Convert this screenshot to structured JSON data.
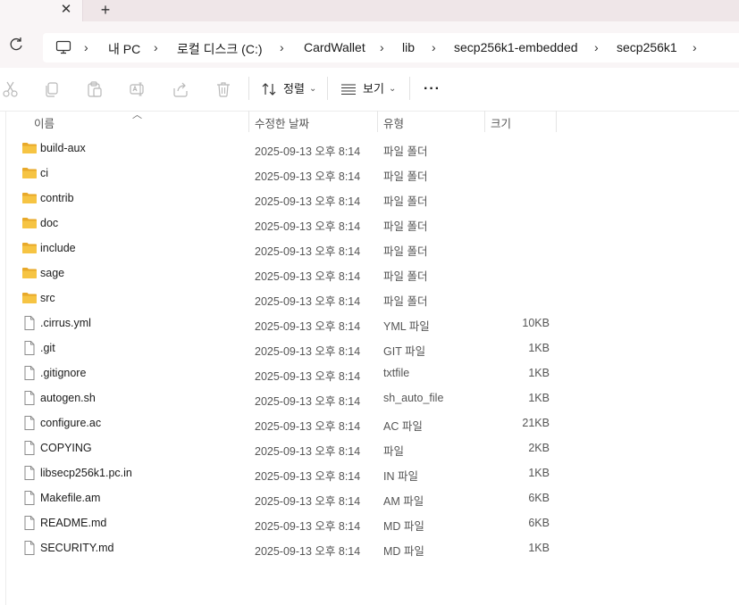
{
  "tabs": {
    "close_glyph": "✕",
    "new_glyph": "+"
  },
  "breadcrumb": [
    "내 PC",
    "로컬 디스크 (C:)",
    "CardWallet",
    "lib",
    "secp256k1-embedded",
    "secp256k1"
  ],
  "toolbar": {
    "sort_label": "정렬",
    "view_label": "보기",
    "more_label": "···"
  },
  "columns": {
    "name": "이름",
    "date": "수정한 날짜",
    "type": "유형",
    "size": "크기"
  },
  "files": [
    {
      "name": "build-aux",
      "date": "2025-09-13 오후 8:14",
      "type": "파일 폴더",
      "size": "",
      "kind": "folder"
    },
    {
      "name": "ci",
      "date": "2025-09-13 오후 8:14",
      "type": "파일 폴더",
      "size": "",
      "kind": "folder"
    },
    {
      "name": "contrib",
      "date": "2025-09-13 오후 8:14",
      "type": "파일 폴더",
      "size": "",
      "kind": "folder"
    },
    {
      "name": "doc",
      "date": "2025-09-13 오후 8:14",
      "type": "파일 폴더",
      "size": "",
      "kind": "folder"
    },
    {
      "name": "include",
      "date": "2025-09-13 오후 8:14",
      "type": "파일 폴더",
      "size": "",
      "kind": "folder"
    },
    {
      "name": "sage",
      "date": "2025-09-13 오후 8:14",
      "type": "파일 폴더",
      "size": "",
      "kind": "folder"
    },
    {
      "name": "src",
      "date": "2025-09-13 오후 8:14",
      "type": "파일 폴더",
      "size": "",
      "kind": "folder"
    },
    {
      "name": ".cirrus.yml",
      "date": "2025-09-13 오후 8:14",
      "type": "YML 파일",
      "size": "10KB",
      "kind": "file"
    },
    {
      "name": ".git",
      "date": "2025-09-13 오후 8:14",
      "type": "GIT 파일",
      "size": "1KB",
      "kind": "file"
    },
    {
      "name": ".gitignore",
      "date": "2025-09-13 오후 8:14",
      "type": "txtfile",
      "size": "1KB",
      "kind": "file"
    },
    {
      "name": "autogen.sh",
      "date": "2025-09-13 오후 8:14",
      "type": "sh_auto_file",
      "size": "1KB",
      "kind": "file"
    },
    {
      "name": "configure.ac",
      "date": "2025-09-13 오후 8:14",
      "type": "AC 파일",
      "size": "21KB",
      "kind": "file"
    },
    {
      "name": "COPYING",
      "date": "2025-09-13 오후 8:14",
      "type": "파일",
      "size": "2KB",
      "kind": "file"
    },
    {
      "name": "libsecp256k1.pc.in",
      "date": "2025-09-13 오후 8:14",
      "type": "IN 파일",
      "size": "1KB",
      "kind": "file"
    },
    {
      "name": "Makefile.am",
      "date": "2025-09-13 오후 8:14",
      "type": "AM 파일",
      "size": "6KB",
      "kind": "file"
    },
    {
      "name": "README.md",
      "date": "2025-09-13 오후 8:14",
      "type": "MD 파일",
      "size": "6KB",
      "kind": "file"
    },
    {
      "name": "SECURITY.md",
      "date": "2025-09-13 오후 8:14",
      "type": "MD 파일",
      "size": "1KB",
      "kind": "file"
    }
  ],
  "colors": {
    "folder": "#f6c443",
    "folder_dark": "#e8a92a",
    "tab_strip": "#efe6e8",
    "address_bg": "#f9f5f6"
  }
}
